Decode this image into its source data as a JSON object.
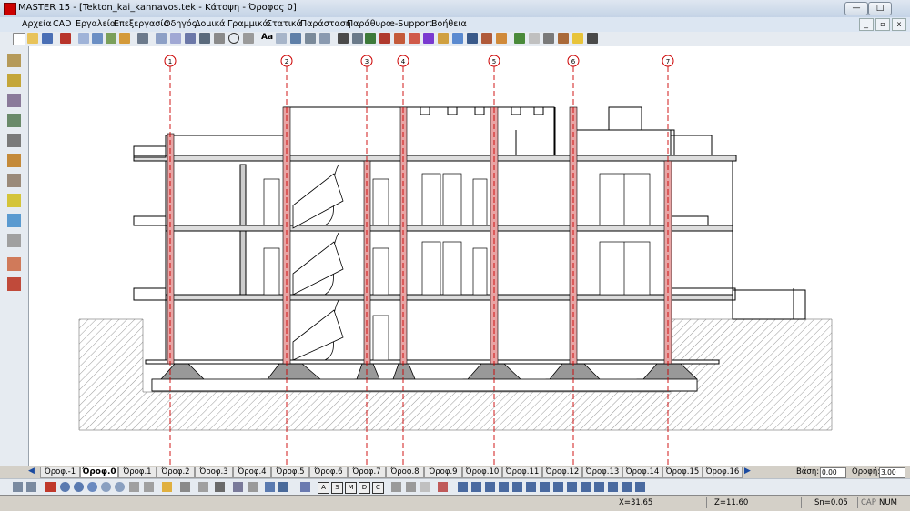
{
  "window": {
    "title": "MASTER 15 - [Tekton_kai_kannavos.tek - Κάτοψη - Όροφος 0]",
    "min_label": "—",
    "max_label": "□",
    "close_label": "✕"
  },
  "menu": {
    "items": [
      "Αρχεία",
      "CAD",
      "Εργαλεία",
      "Επεξεργασία",
      "Οδηγός",
      "Δομικά",
      "Γραμμικά",
      "Στατικά",
      "Παράσταση",
      "Παράθυρο",
      "e-Support",
      "Βοήθεια"
    ]
  },
  "drawing": {
    "axis_labels": [
      "1",
      "2",
      "3",
      "4",
      "5",
      "6",
      "7"
    ],
    "line_color": "#000000",
    "axis_color": "#cc0000",
    "column_color": "#e9a4a4"
  },
  "floor_tabs": {
    "labels": [
      "Όροφ.-1",
      "Όροφ.0",
      "Όροφ.1",
      "Όροφ.2",
      "Όροφ.3",
      "Όροφ.4",
      "Όροφ.5",
      "Όροφ.6",
      "Όροφ.7",
      "Όροφ.8",
      "Όροφ.9",
      "Όροφ.10",
      "Όροφ.11",
      "Όροφ.12",
      "Όροφ.13",
      "Όροφ.14",
      "Όροφ.15",
      "Όροφ.16"
    ],
    "active": "Όροφ.0",
    "base_label": "Βάση:",
    "base_value": "0.00",
    "ceiling_label": "Οροφή:",
    "ceiling_value": "3.00"
  },
  "status": {
    "x": "X=31.65",
    "z": "Z=11.60",
    "snap": "Sn=0.05",
    "caps": "CAP",
    "num": "NUM"
  }
}
